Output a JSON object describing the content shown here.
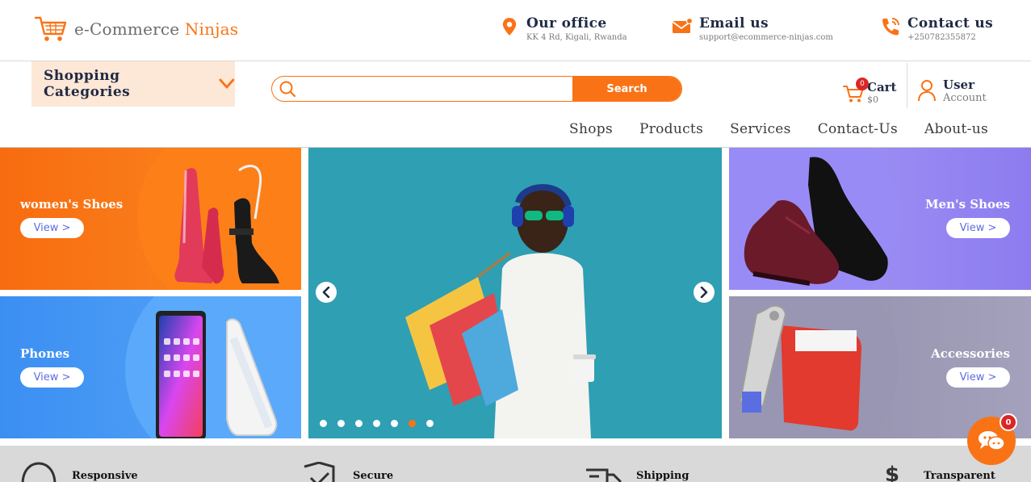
{
  "header": {
    "logo_text_main": "e-Commerce ",
    "logo_text_accent": "Ninjas",
    "office": {
      "title": "Our office",
      "sub": "KK 4 Rd, Kigali, Rwanda"
    },
    "email": {
      "title": "Email us",
      "sub": "support@ecommerce-ninjas.com"
    },
    "contact": {
      "title": "Contact us",
      "sub": "+250782355872"
    }
  },
  "nav": {
    "categories_label": "Shopping Categories",
    "search_placeholder": "",
    "search_button": "Search",
    "cart": {
      "label": "Cart",
      "amount": "$0",
      "count": "0"
    },
    "account": {
      "title": "User",
      "sub": "Account"
    },
    "menu": [
      "Shops",
      "Products",
      "Services",
      "Contact-Us",
      "About-us"
    ]
  },
  "banners": {
    "womens": {
      "title": "women's Shoes",
      "button": "View >"
    },
    "phones": {
      "title": "Phones",
      "button": "View >"
    },
    "mens": {
      "title": "Men's Shoes",
      "button": "View >"
    },
    "accessories": {
      "title": "Accessories",
      "button": "View >"
    }
  },
  "carousel": {
    "slides": 7,
    "active_index": 5
  },
  "features": [
    "Responsive",
    "Secure",
    "Shipping",
    "Transparent"
  ],
  "chat": {
    "count": "0"
  },
  "colors": {
    "accent": "#f97316",
    "navy": "#1f2a44",
    "badge": "#dc2626"
  }
}
